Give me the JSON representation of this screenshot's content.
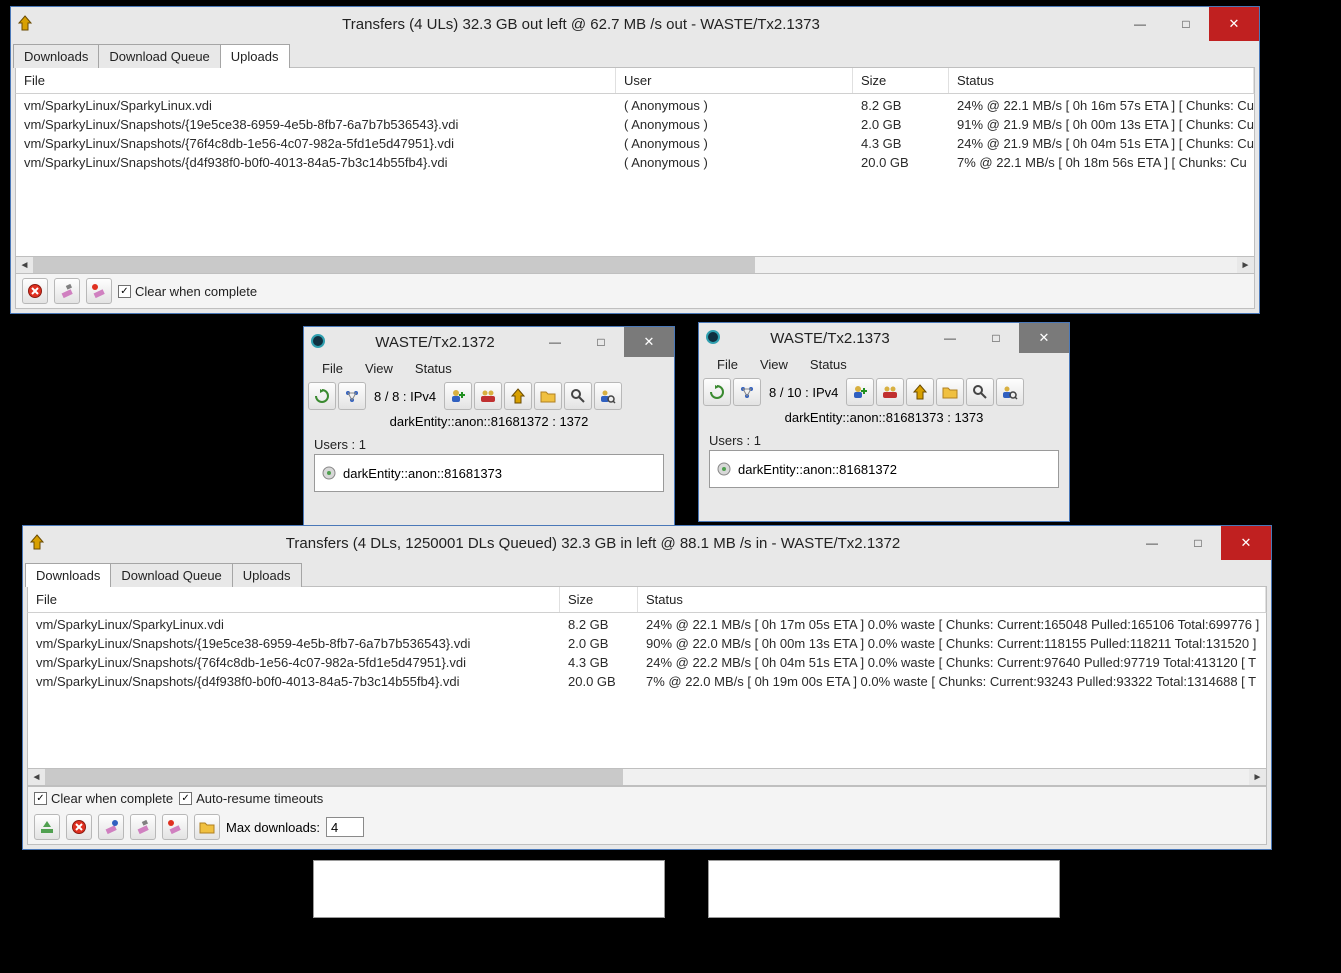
{
  "window1": {
    "title": "Transfers (4 ULs) 32.3 GB out left @ 62.7 MB /s out  - WASTE/Tx2.1373",
    "tabs": [
      "Downloads",
      "Download Queue",
      "Uploads"
    ],
    "activeTab": 2,
    "headers": [
      "File",
      "User",
      "Size",
      "Status"
    ],
    "rows": [
      {
        "file": "vm/SparkyLinux/SparkyLinux.vdi",
        "user": "( Anonymous )",
        "size": "8.2 GB",
        "status": "24% @ 22.1 MB/s [ 0h 16m 57s ETA ] [ Chunks: Cu"
      },
      {
        "file": "vm/SparkyLinux/Snapshots/{19e5ce38-6959-4e5b-8fb7-6a7b7b536543}.vdi",
        "user": "( Anonymous )",
        "size": "2.0 GB",
        "status": "91% @ 21.9 MB/s [ 0h 00m 13s ETA ] [ Chunks: Cu"
      },
      {
        "file": "vm/SparkyLinux/Snapshots/{76f4c8db-1e56-4c07-982a-5fd1e5d47951}.vdi",
        "user": "( Anonymous )",
        "size": "4.3 GB",
        "status": "24% @ 21.9 MB/s [ 0h 04m 51s ETA ] [ Chunks: Cu"
      },
      {
        "file": "vm/SparkyLinux/Snapshots/{d4f938f0-b0f0-4013-84a5-7b3c14b55fb4}.vdi",
        "user": "( Anonymous )",
        "size": "20.0 GB",
        "status": "7% @ 22.1 MB/s [ 0h 18m 56s ETA ] [ Chunks: Cu"
      }
    ],
    "clear_label": "Clear when complete"
  },
  "window2": {
    "title": "WASTE/Tx2.1372",
    "menus": [
      "File",
      "View",
      "Status"
    ],
    "conn": "8 / 8 : IPv4",
    "ident": "darkEntity::anon::81681372 : 1372",
    "users_label": "Users : 1",
    "user_entry": "darkEntity::anon::81681373"
  },
  "window3": {
    "title": "WASTE/Tx2.1373",
    "menus": [
      "File",
      "View",
      "Status"
    ],
    "conn": "8 / 10 : IPv4",
    "ident": "darkEntity::anon::81681373 : 1373",
    "users_label": "Users : 1",
    "user_entry": "darkEntity::anon::81681372"
  },
  "window4": {
    "title": "Transfers (4 DLs, 1250001 DLs Queued) 32.3 GB in left @ 88.1 MB /s in  - WASTE/Tx2.1372",
    "tabs": [
      "Downloads",
      "Download Queue",
      "Uploads"
    ],
    "activeTab": 0,
    "headers": [
      "File",
      "Size",
      "Status"
    ],
    "rows": [
      {
        "file": "vm/SparkyLinux/SparkyLinux.vdi",
        "size": "8.2 GB",
        "status": "24% @ 22.1 MB/s [ 0h 17m 05s ETA ] 0.0% waste [ Chunks: Current:165048 Pulled:165106 Total:699776 ]"
      },
      {
        "file": "vm/SparkyLinux/Snapshots/{19e5ce38-6959-4e5b-8fb7-6a7b7b536543}.vdi",
        "size": "2.0 GB",
        "status": "90% @ 22.0 MB/s [ 0h 00m 13s ETA ] 0.0% waste [ Chunks: Current:118155 Pulled:118211 Total:131520 ]"
      },
      {
        "file": "vm/SparkyLinux/Snapshots/{76f4c8db-1e56-4c07-982a-5fd1e5d47951}.vdi",
        "size": "4.3 GB",
        "status": "24% @ 22.2 MB/s [ 0h 04m 51s ETA ] 0.0% waste [ Chunks: Current:97640 Pulled:97719 Total:413120 [ T"
      },
      {
        "file": "vm/SparkyLinux/Snapshots/{d4f938f0-b0f0-4013-84a5-7b3c14b55fb4}.vdi",
        "size": "20.0 GB",
        "status": "7% @ 22.0 MB/s [ 0h 19m 00s ETA ] 0.0% waste [ Chunks: Current:93243 Pulled:93322 Total:1314688 [ T"
      }
    ],
    "clear_label": "Clear when complete",
    "auto_label": "Auto-resume timeouts",
    "max_dl_label": "Max downloads:",
    "max_dl_value": "4"
  }
}
